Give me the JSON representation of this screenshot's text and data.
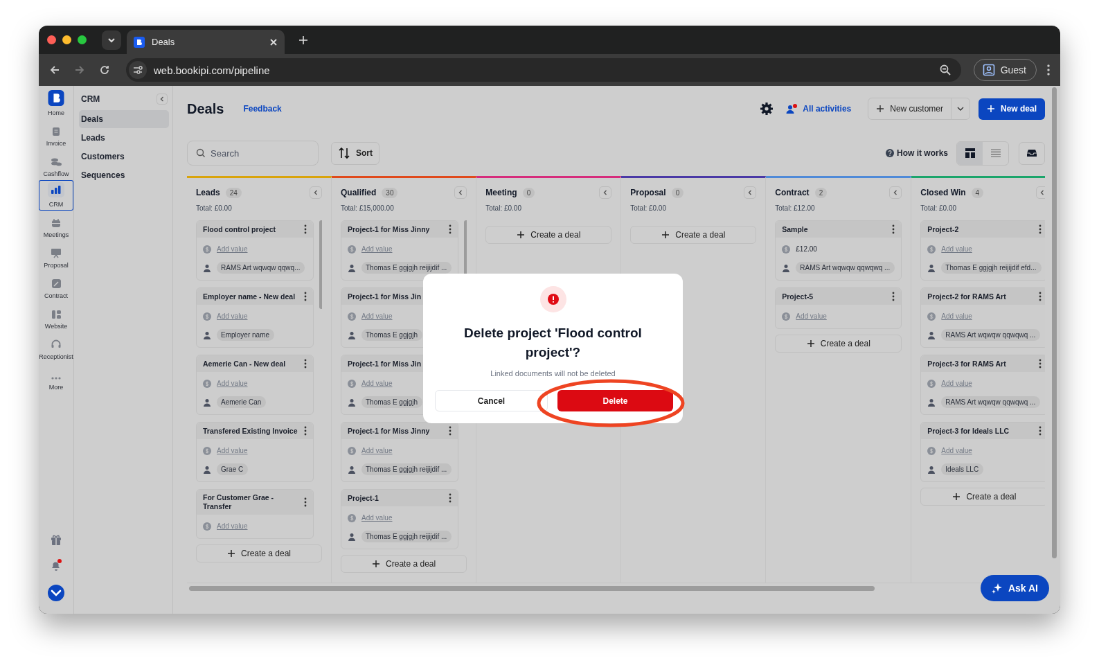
{
  "browser": {
    "tab_title": "Deals",
    "url": "web.bookipi.com/pipeline",
    "profile": "Guest"
  },
  "rail": [
    {
      "label": "Home",
      "selected": false
    },
    {
      "label": "Invoice",
      "selected": false
    },
    {
      "label": "Cashflow",
      "selected": false
    },
    {
      "label": "CRM",
      "selected": true
    },
    {
      "label": "Meetings",
      "selected": false
    },
    {
      "label": "Proposal",
      "selected": false
    },
    {
      "label": "Contract",
      "selected": false
    },
    {
      "label": "Website",
      "selected": false
    },
    {
      "label": "Receptionist",
      "selected": false
    },
    {
      "label": "More",
      "selected": false
    }
  ],
  "nav": {
    "title": "CRM",
    "items": [
      {
        "label": "Deals",
        "selected": true
      },
      {
        "label": "Leads",
        "selected": false
      },
      {
        "label": "Customers",
        "selected": false
      },
      {
        "label": "Sequences",
        "selected": false
      }
    ]
  },
  "header": {
    "title": "Deals",
    "feedback": "Feedback",
    "activities": "All activities",
    "new_customer": "New customer",
    "new_deal": "New deal"
  },
  "toolbar": {
    "search_placeholder": "Search",
    "sort": "Sort",
    "how_it_works": "How it works",
    "views": [
      {
        "selected": true
      },
      {
        "selected": false
      }
    ]
  },
  "columns": [
    {
      "name": "Leads",
      "count": "24",
      "total": "Total: £0.00",
      "color": "#d9a40c",
      "create": "Create a deal",
      "cards": [
        {
          "title": "Flood control project",
          "value": {
            "kind": "placeholder",
            "text": "Add value"
          },
          "contact": "RAMS Art wqwqw qqwq..."
        },
        {
          "title": "Employer name - New deal",
          "value": {
            "kind": "placeholder",
            "text": "Add value"
          },
          "contact": "Employer name"
        },
        {
          "title": "Aemerie Can - New deal",
          "value": {
            "kind": "placeholder",
            "text": "Add value"
          },
          "contact": "Aemerie Can"
        },
        {
          "title": "Transfered Existing Invoice",
          "value": {
            "kind": "placeholder",
            "text": "Add value"
          },
          "contact": "Grae C"
        },
        {
          "title": "For Customer Grae - Transfer",
          "value": {
            "kind": "placeholder",
            "text": "Add value"
          }
        }
      ]
    },
    {
      "name": "Qualified",
      "count": "30",
      "total": "Total: £15,000.00",
      "color": "#e04a1c",
      "create": "Create a deal",
      "cards": [
        {
          "title": "Project-1 for Miss Jinny",
          "value": {
            "kind": "placeholder",
            "text": "Add value"
          },
          "contact": "Thomas E ggjgjh reijijdif ..."
        },
        {
          "title": "Project-1 for Miss Jin",
          "value": {
            "kind": "placeholder",
            "text": "Add value"
          },
          "contact": "Thomas E ggjgjh"
        },
        {
          "title": "Project-1 for Miss Jin",
          "value": {
            "kind": "placeholder",
            "text": "Add value"
          },
          "contact": "Thomas E ggjgjh"
        },
        {
          "title": "Project-1 for Miss Jinny",
          "value": {
            "kind": "placeholder",
            "text": "Add value"
          },
          "contact": "Thomas E ggjgjh reijijdif ..."
        },
        {
          "title": "Project-1",
          "value": {
            "kind": "placeholder",
            "text": "Add value"
          },
          "contact": "Thomas E ggjgjh reijijdif ..."
        }
      ]
    },
    {
      "name": "Meeting",
      "count": "0",
      "total": "Total: £0.00",
      "color": "#d62c7c",
      "create": "Create a deal"
    },
    {
      "name": "Proposal",
      "count": "0",
      "total": "Total: £0.00",
      "color": "#4a39a6",
      "create": "Create a deal"
    },
    {
      "name": "Contract",
      "count": "2",
      "total": "Total: £12.00",
      "color": "#4f8ad8",
      "create": "Create a deal",
      "cards": [
        {
          "title": "Sample",
          "value": {
            "kind": "amount",
            "text": "£12.00"
          },
          "contact": "RAMS Art wqwqw qqwqwq ..."
        },
        {
          "title": "Project-5",
          "value": {
            "kind": "placeholder",
            "text": "Add value"
          }
        }
      ]
    },
    {
      "name": "Closed Win",
      "count": "4",
      "total": "Total: £0.00",
      "color": "#1ba56b",
      "create": "Create a deal",
      "cards": [
        {
          "title": "Project-2",
          "value": {
            "kind": "placeholder",
            "text": "Add value"
          },
          "contact": "Thomas E ggjgjh reijijdif efd..."
        },
        {
          "title": "Project-2 for RAMS Art",
          "value": {
            "kind": "placeholder",
            "text": "Add value"
          },
          "contact": "RAMS Art wqwqw qqwqwq ..."
        },
        {
          "title": "Project-3 for RAMS Art",
          "value": {
            "kind": "placeholder",
            "text": "Add value"
          },
          "contact": "RAMS Art wqwqw qqwqwq ..."
        },
        {
          "title": "Project-3 for Ideals LLC",
          "value": {
            "kind": "placeholder",
            "text": "Add value"
          },
          "contact": "Ideals LLC"
        }
      ]
    }
  ],
  "modal": {
    "title": "Delete project 'Flood control project'?",
    "note": "Linked documents will not be deleted",
    "cancel": "Cancel",
    "confirm": "Delete"
  },
  "ask_ai": "Ask AI"
}
